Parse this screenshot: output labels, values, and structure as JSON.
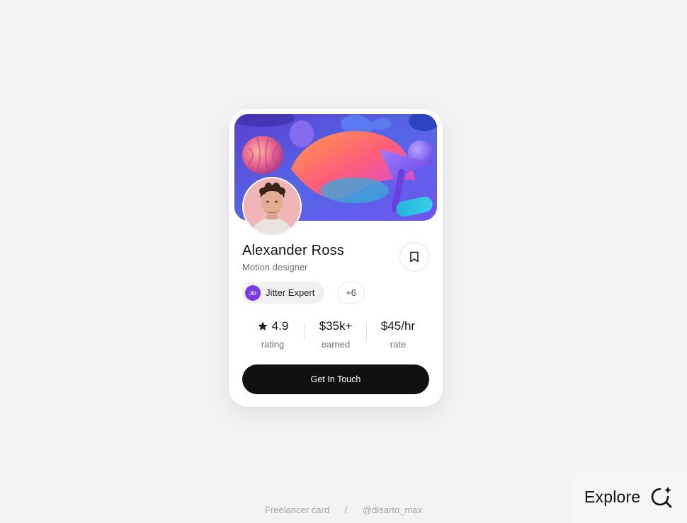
{
  "profile": {
    "name": "Alexander Ross",
    "role": "Motion designer",
    "badge_logo": "Jttr",
    "badge_label": "Jitter Expert",
    "more_count": "+6"
  },
  "stats": [
    {
      "value": "4.9",
      "label": "rating",
      "icon": "star-icon"
    },
    {
      "value": "$35k+",
      "label": "earned"
    },
    {
      "value": "$45/hr",
      "label": "rate"
    }
  ],
  "cta_label": "Get In Touch",
  "footer": {
    "left": "Freelancer card",
    "separator": "/",
    "right": "@disarto_max"
  },
  "explore_label": "Explore",
  "icons": {
    "bookmark": "bookmark-icon",
    "explore": "sparkle-search-icon"
  },
  "colors": {
    "background": "#f3f3f5",
    "card": "#ffffff",
    "cta": "#111111",
    "badge_logo": "#7a3be6"
  }
}
